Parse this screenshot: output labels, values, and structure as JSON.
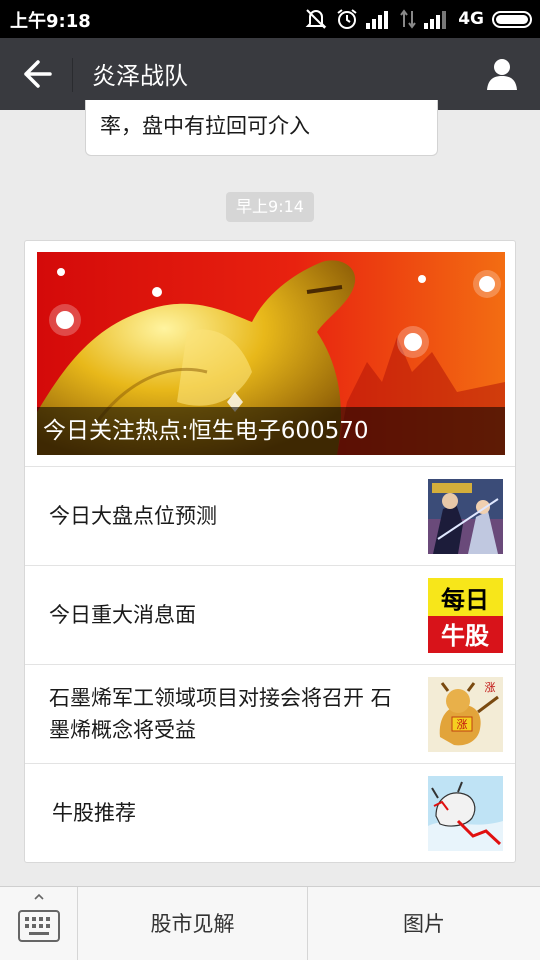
{
  "status_bar": {
    "time": "上午9:18",
    "network": "4G"
  },
  "header": {
    "title": "炎泽战队"
  },
  "chat": {
    "prev_message": "率，盘中有拉回可介入",
    "timestamp": "早上9:14"
  },
  "article_card": {
    "cover_title": "今日关注热点:恒生电子600570",
    "items": [
      {
        "title": "今日大盘点位预测",
        "thumb_icon": "fantasy-character-thumbnail"
      },
      {
        "title": "今日重大消息面",
        "thumb_icon": "daily-bull-stock-thumbnail",
        "thumb_text": [
          "每日",
          "牛股"
        ]
      },
      {
        "title": "石墨烯军工领域项目对接会将召开 石墨烯概念将受益",
        "thumb_icon": "bull-rise-thumbnail",
        "thumb_text": [
          "涨",
          "涨"
        ]
      },
      {
        "title": "牛股推荐",
        "thumb_icon": "bull-chart-thumbnail"
      }
    ]
  },
  "bottom_menu": {
    "items": [
      "股市见解",
      "图片"
    ]
  }
}
